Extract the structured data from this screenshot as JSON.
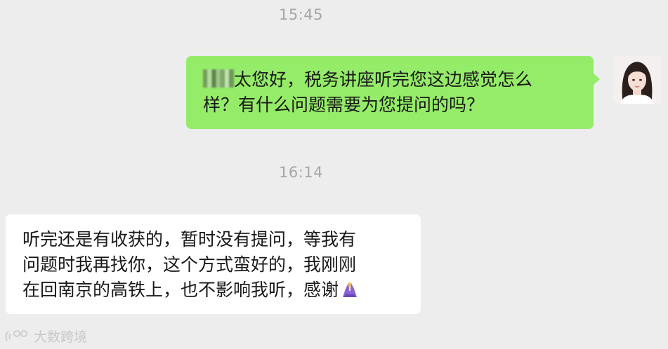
{
  "chat": {
    "messages": [
      {
        "time": "15:45",
        "sender": "me",
        "redacted_prefix": true,
        "text_line1": "太您好，税务讲座听完您这边感觉怎么",
        "text_line2": "样？有什么问题需要为您提问的吗？"
      },
      {
        "time": "16:14",
        "sender": "other",
        "text_line1": "听完还是有收获的，暂时没有提问，等我有",
        "text_line2": "问题时我再找你，这个方式蛮好的，我刚刚",
        "text_line3": "在回南京的高铁上，也不影响我听，感谢",
        "emoji": "folded-hands"
      }
    ]
  },
  "avatar": {
    "icon": "user-avatar-woman"
  },
  "watermark": {
    "text": "大数跨境",
    "logo": "sound-wave-logo"
  },
  "colors": {
    "background": "#ededed",
    "sent_bubble": "#95ec69",
    "received_bubble": "#ffffff",
    "timestamp": "#a6a6a6"
  }
}
